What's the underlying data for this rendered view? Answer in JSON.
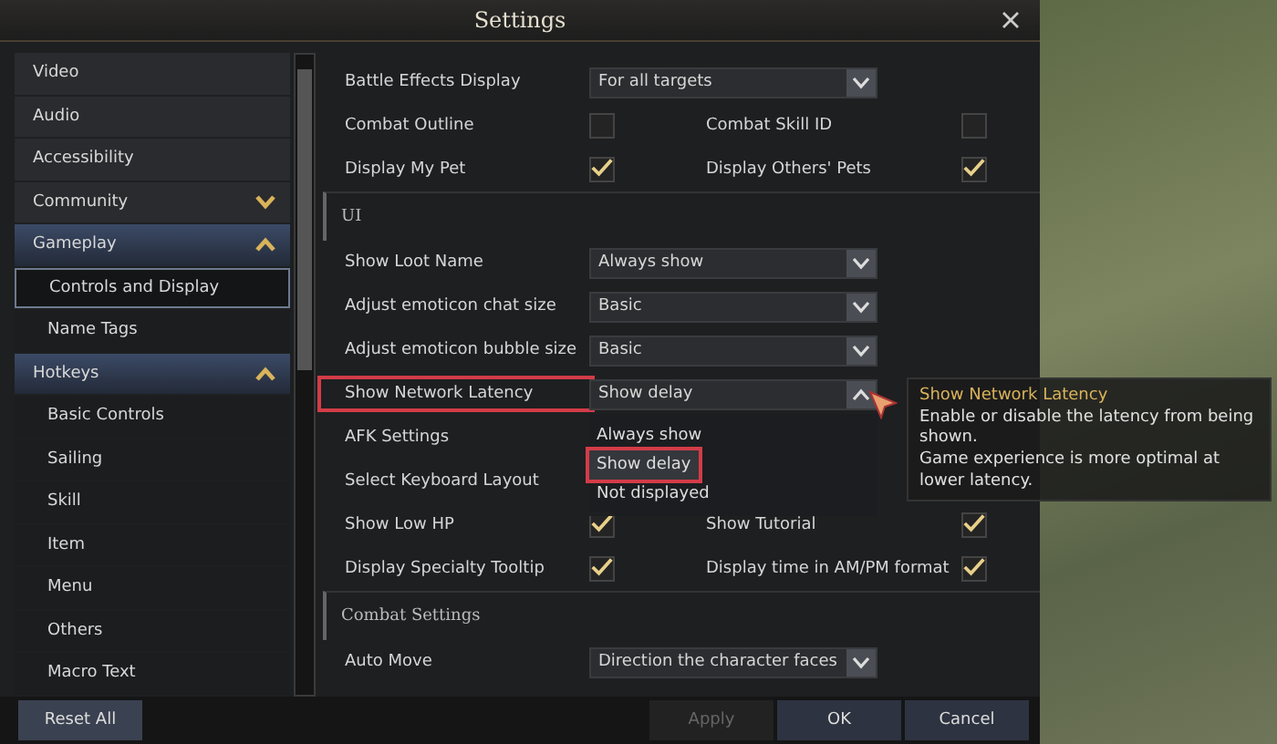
{
  "window": {
    "title": "Settings"
  },
  "sidebar": {
    "items": [
      {
        "label": "Video",
        "kind": "category",
        "selected": false
      },
      {
        "label": "Audio",
        "kind": "category",
        "selected": false
      },
      {
        "label": "Accessibility",
        "kind": "category",
        "selected": false
      },
      {
        "label": "Community",
        "kind": "group",
        "expanded": false,
        "selected": false
      },
      {
        "label": "Gameplay",
        "kind": "group",
        "expanded": true,
        "selected": false
      },
      {
        "label": "Controls and Display",
        "kind": "sub",
        "selected": true
      },
      {
        "label": "Name Tags",
        "kind": "sub",
        "selected": false
      },
      {
        "label": "Hotkeys",
        "kind": "group",
        "expanded": true,
        "selected": false
      },
      {
        "label": "Basic Controls",
        "kind": "sub",
        "selected": false
      },
      {
        "label": "Sailing",
        "kind": "sub",
        "selected": false
      },
      {
        "label": "Skill",
        "kind": "sub",
        "selected": false
      },
      {
        "label": "Item",
        "kind": "sub",
        "selected": false
      },
      {
        "label": "Menu",
        "kind": "sub",
        "selected": false
      },
      {
        "label": "Others",
        "kind": "sub",
        "selected": false
      },
      {
        "label": "Macro Text",
        "kind": "sub",
        "selected": false
      }
    ]
  },
  "settings": [
    {
      "kind": "dropdown",
      "label": "Battle Effects Display",
      "value": "For all targets",
      "expanded": false,
      "highlighted": false
    },
    {
      "kind": "checks",
      "items": [
        {
          "label": "Combat Outline",
          "checked": false
        },
        {
          "label": "Combat Skill ID",
          "checked": false
        }
      ]
    },
    {
      "kind": "checks",
      "items": [
        {
          "label": "Display My Pet",
          "checked": true
        },
        {
          "label": "Display Others' Pets",
          "checked": true
        }
      ]
    },
    {
      "kind": "section",
      "label": "UI"
    },
    {
      "kind": "dropdown",
      "label": "Show Loot Name",
      "value": "Always show",
      "expanded": false,
      "highlighted": false
    },
    {
      "kind": "dropdown",
      "label": "Adjust emoticon chat size",
      "value": "Basic",
      "expanded": false,
      "highlighted": false
    },
    {
      "kind": "dropdown",
      "label": "Adjust emoticon bubble size",
      "value": "Basic",
      "expanded": false,
      "highlighted": false
    },
    {
      "kind": "dropdown",
      "label": "Show Network Latency",
      "value": "Show delay",
      "expanded": true,
      "highlighted": true,
      "options": [
        {
          "label": "Always show",
          "selected": false,
          "highlighted": false
        },
        {
          "label": "Show delay",
          "selected": true,
          "highlighted": true
        },
        {
          "label": "Not displayed",
          "selected": false,
          "highlighted": false
        }
      ]
    },
    {
      "kind": "label",
      "label": "AFK Settings"
    },
    {
      "kind": "label",
      "label": "Select Keyboard Layout"
    },
    {
      "kind": "checks",
      "items": [
        {
          "label": "Show Low HP",
          "checked": true
        },
        {
          "label": "Show Tutorial",
          "checked": true
        }
      ]
    },
    {
      "kind": "checks",
      "items": [
        {
          "label": "Display Specialty Tooltip",
          "checked": true
        },
        {
          "label": "Display time in AM/PM format",
          "checked": true
        }
      ]
    },
    {
      "kind": "section",
      "label": "Combat Settings"
    },
    {
      "kind": "dropdown",
      "label": "Auto Move",
      "value": "Direction the character faces",
      "expanded": false,
      "highlighted": false
    }
  ],
  "tooltip": {
    "title": "Show Network Latency",
    "lines": [
      "Enable or disable the latency from being shown.",
      "Game experience is more optimal at lower latency."
    ]
  },
  "footer": {
    "reset": "Reset All",
    "buttons": [
      {
        "label": "Apply",
        "disabled": true
      },
      {
        "label": "OK",
        "disabled": false
      },
      {
        "label": "Cancel",
        "disabled": false
      }
    ]
  }
}
